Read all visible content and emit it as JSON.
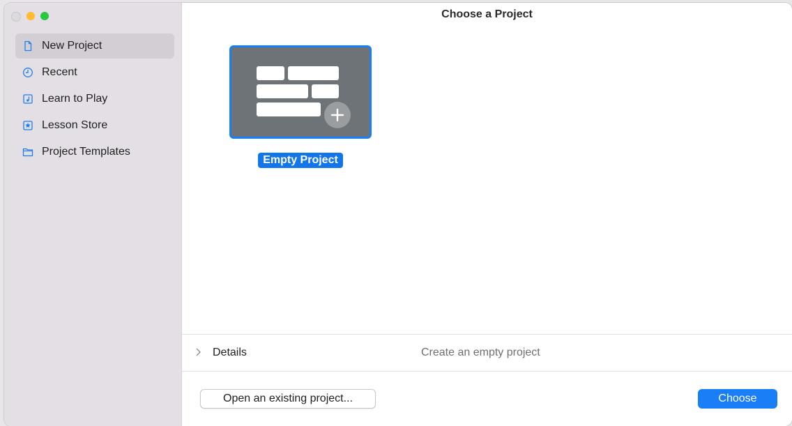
{
  "window": {
    "title": "Choose a Project",
    "traffic_lights": [
      "close",
      "minimize",
      "maximize"
    ]
  },
  "sidebar": {
    "items": [
      {
        "label": "New Project",
        "icon": "doc-icon",
        "active": true
      },
      {
        "label": "Recent",
        "icon": "clock-icon",
        "active": false
      },
      {
        "label": "Learn to Play",
        "icon": "music-note-icon",
        "active": false
      },
      {
        "label": "Lesson Store",
        "icon": "star-icon",
        "active": false
      },
      {
        "label": "Project Templates",
        "icon": "folder-icon",
        "active": false
      }
    ]
  },
  "templates": [
    {
      "label": "Empty Project",
      "icon": "empty-project-icon",
      "selected": true
    }
  ],
  "details": {
    "label": "Details",
    "description": "Create an empty project"
  },
  "footer": {
    "open_label": "Open an existing project...",
    "choose_label": "Choose"
  },
  "colors": {
    "accent": "#1a7ef6",
    "sidebar_bg": "#e4dfe4",
    "tile_bg": "#6e7377"
  }
}
